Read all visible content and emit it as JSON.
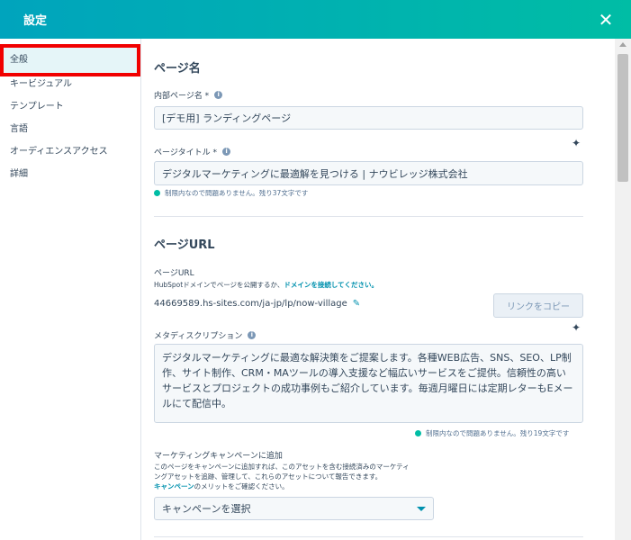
{
  "header": {
    "title": "設定",
    "close_glyph": "✕"
  },
  "sidebar": {
    "items": [
      {
        "label": "全般",
        "active": true
      },
      {
        "label": "キービジュアル"
      },
      {
        "label": "テンプレート"
      },
      {
        "label": "言語"
      },
      {
        "label": "オーディエンスアクセス"
      },
      {
        "label": "詳細"
      }
    ]
  },
  "page_name": {
    "section_title": "ページ名",
    "internal_label": "内部ページ名 *",
    "internal_value": "[デモ用] ランディングページ",
    "title_label": "ページタイトル *",
    "title_value": "デジタルマーケティングに最適解を見つける | ナウビレッジ株式会社",
    "title_hint": "制限内なので問題ありません。残り37文字です"
  },
  "page_url": {
    "section_title": "ページURL",
    "label": "ページURL",
    "desc_prefix": "HubSpotドメインでページを公開するか、",
    "desc_link": "ドメインを接続してください。",
    "url": "44669589.hs-sites.com/ja-jp/lp/now-village",
    "copy_button": "リンクをコピー"
  },
  "meta": {
    "label": "メタディスクリプション",
    "value": "デジタルマーケティングに最適な解決策をご提案します。各種WEB広告、SNS、SEO、LP制作、サイト制作、CRM・MAツールの導入支援など幅広いサービスをご提供。信頼性の高いサービスとプロジェクトの成功事例もご紹介しています。毎週月曜日には定期レターもEメールにて配信中。",
    "hint": "制限内なので問題ありません。残り19文字です"
  },
  "campaign": {
    "label": "マーケティングキャンペーンに追加",
    "desc_line1": "このページをキャンペーンに追加すれば、このアセットを含む接続済みのマーケティ",
    "desc_line2": "ングアセットを追跡、管理して、これらのアセットについて報告できます。",
    "desc_link": "キャンペーン",
    "desc_suffix": "のメリットをご確認ください。",
    "select_value": "キャンペーンを選択"
  },
  "icons": {
    "info": "i",
    "sparkle": "✦",
    "pencil": "✎"
  },
  "colors": {
    "header_start": "#00a4bd",
    "header_end": "#00bda5",
    "link": "#0091ae",
    "highlight": "#f10000"
  }
}
